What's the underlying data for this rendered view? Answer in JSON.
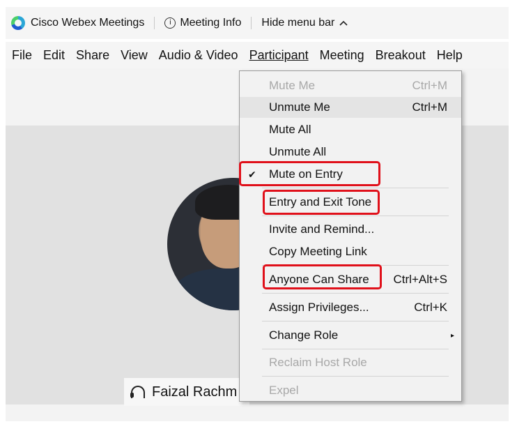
{
  "topbar": {
    "app_name": "Cisco Webex Meetings",
    "meeting_info": "Meeting Info",
    "hide_menu_bar": "Hide menu bar",
    "info_glyph": "i",
    "caret_glyph": "^"
  },
  "menubar": {
    "items": [
      "File",
      "Edit",
      "Share",
      "View",
      "Audio & Video",
      "Participant",
      "Meeting",
      "Breakout",
      "Help"
    ]
  },
  "participant_menu": {
    "items": [
      {
        "label": "Mute Me",
        "shortcut": "Ctrl+M",
        "disabled": true
      },
      {
        "label": "Unmute Me",
        "shortcut": "Ctrl+M",
        "disabled": false,
        "hover": true
      },
      {
        "label": "Mute All",
        "shortcut": "",
        "disabled": false
      },
      {
        "label": "Unmute All",
        "shortcut": "",
        "disabled": false
      },
      {
        "label": "Mute on Entry",
        "shortcut": "",
        "disabled": false,
        "checked": true,
        "highlighted": true
      },
      {
        "label": "Entry and Exit Tone",
        "shortcut": "",
        "disabled": false,
        "highlighted": true
      },
      {
        "label": "Invite and Remind...",
        "shortcut": "",
        "disabled": false
      },
      {
        "label": "Copy Meeting Link",
        "shortcut": "",
        "disabled": false
      },
      {
        "label": "Anyone Can Share",
        "shortcut": "Ctrl+Alt+S",
        "disabled": false,
        "highlighted": true
      },
      {
        "label": "Assign Privileges...",
        "shortcut": "Ctrl+K",
        "disabled": false
      },
      {
        "label": "Change Role",
        "shortcut": "",
        "disabled": false,
        "submenu": true
      },
      {
        "label": "Reclaim Host Role",
        "shortcut": "",
        "disabled": true
      },
      {
        "label": "Expel",
        "shortcut": "",
        "disabled": true
      }
    ],
    "check_glyph": "✔",
    "submenu_glyph": "▸"
  },
  "video": {
    "participant_name": "Faizal Rachm"
  },
  "colors": {
    "highlight_red": "#e0101a",
    "menu_bg": "#f2f2f2",
    "disabled_text": "#a8a8a8",
    "stage_bg": "#e1e1e1"
  }
}
